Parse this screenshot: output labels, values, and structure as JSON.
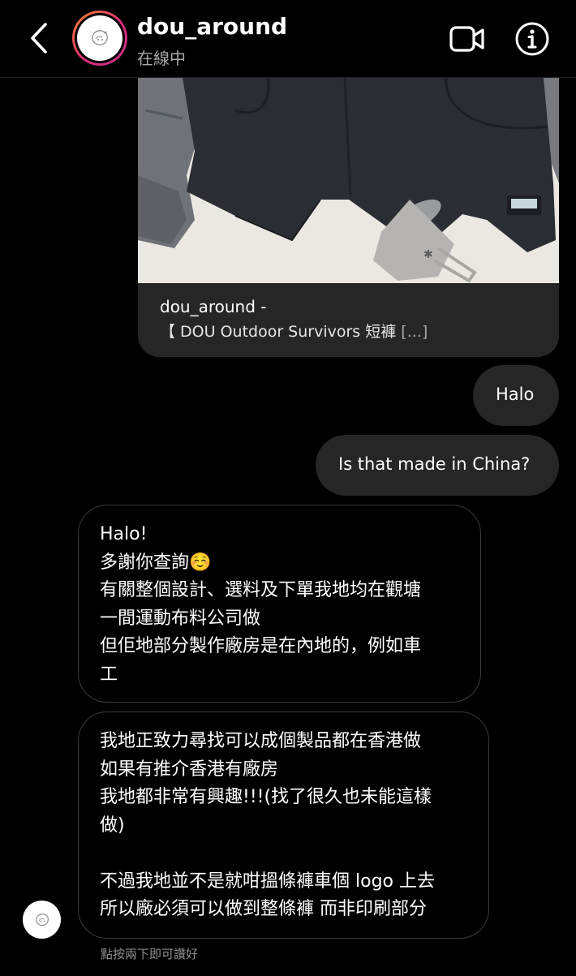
{
  "header": {
    "username": "dou_around",
    "status": "在線中",
    "icons": {
      "back": "chevron-left-icon",
      "video": "video-call-icon",
      "info": "info-icon"
    }
  },
  "shared_post": {
    "author": "dou_around -",
    "caption": "【 DOU Outdoor Survivors 短褲",
    "caption_more": " [...]"
  },
  "messages": [
    {
      "direction": "outgoing",
      "lines": [
        "Halo"
      ]
    },
    {
      "direction": "outgoing",
      "lines": [
        "Is that made in China?"
      ]
    },
    {
      "direction": "incoming",
      "lines": [
        "Halo!",
        "多謝你查詢☺️",
        "有關整個設計、選料及下單我地均在觀塘",
        "一間運動布料公司做",
        "但佢地部分製作廠房是在內地的，例如車",
        "工"
      ]
    },
    {
      "direction": "incoming",
      "lines": [
        "我地正致力尋找可以成個製品都在香港做",
        "如果有推介香港有廠房",
        "我地都非常有興趣!!!(找了很久也未能這樣",
        "做)",
        "",
        "不過我地並不是就咁搵條褲車個 logo 上去",
        "所以廠必須可以做到整條褲 而非印刷部分"
      ]
    }
  ],
  "hint": "點按兩下即可讚好",
  "colors": {
    "background": "#000000",
    "outgoing_bubble": "#262626",
    "incoming_border": "#3b3b3b",
    "secondary_text": "#a8a8a8",
    "story_ring": [
      "#f58529",
      "#dd2a7b",
      "#c13584"
    ]
  }
}
